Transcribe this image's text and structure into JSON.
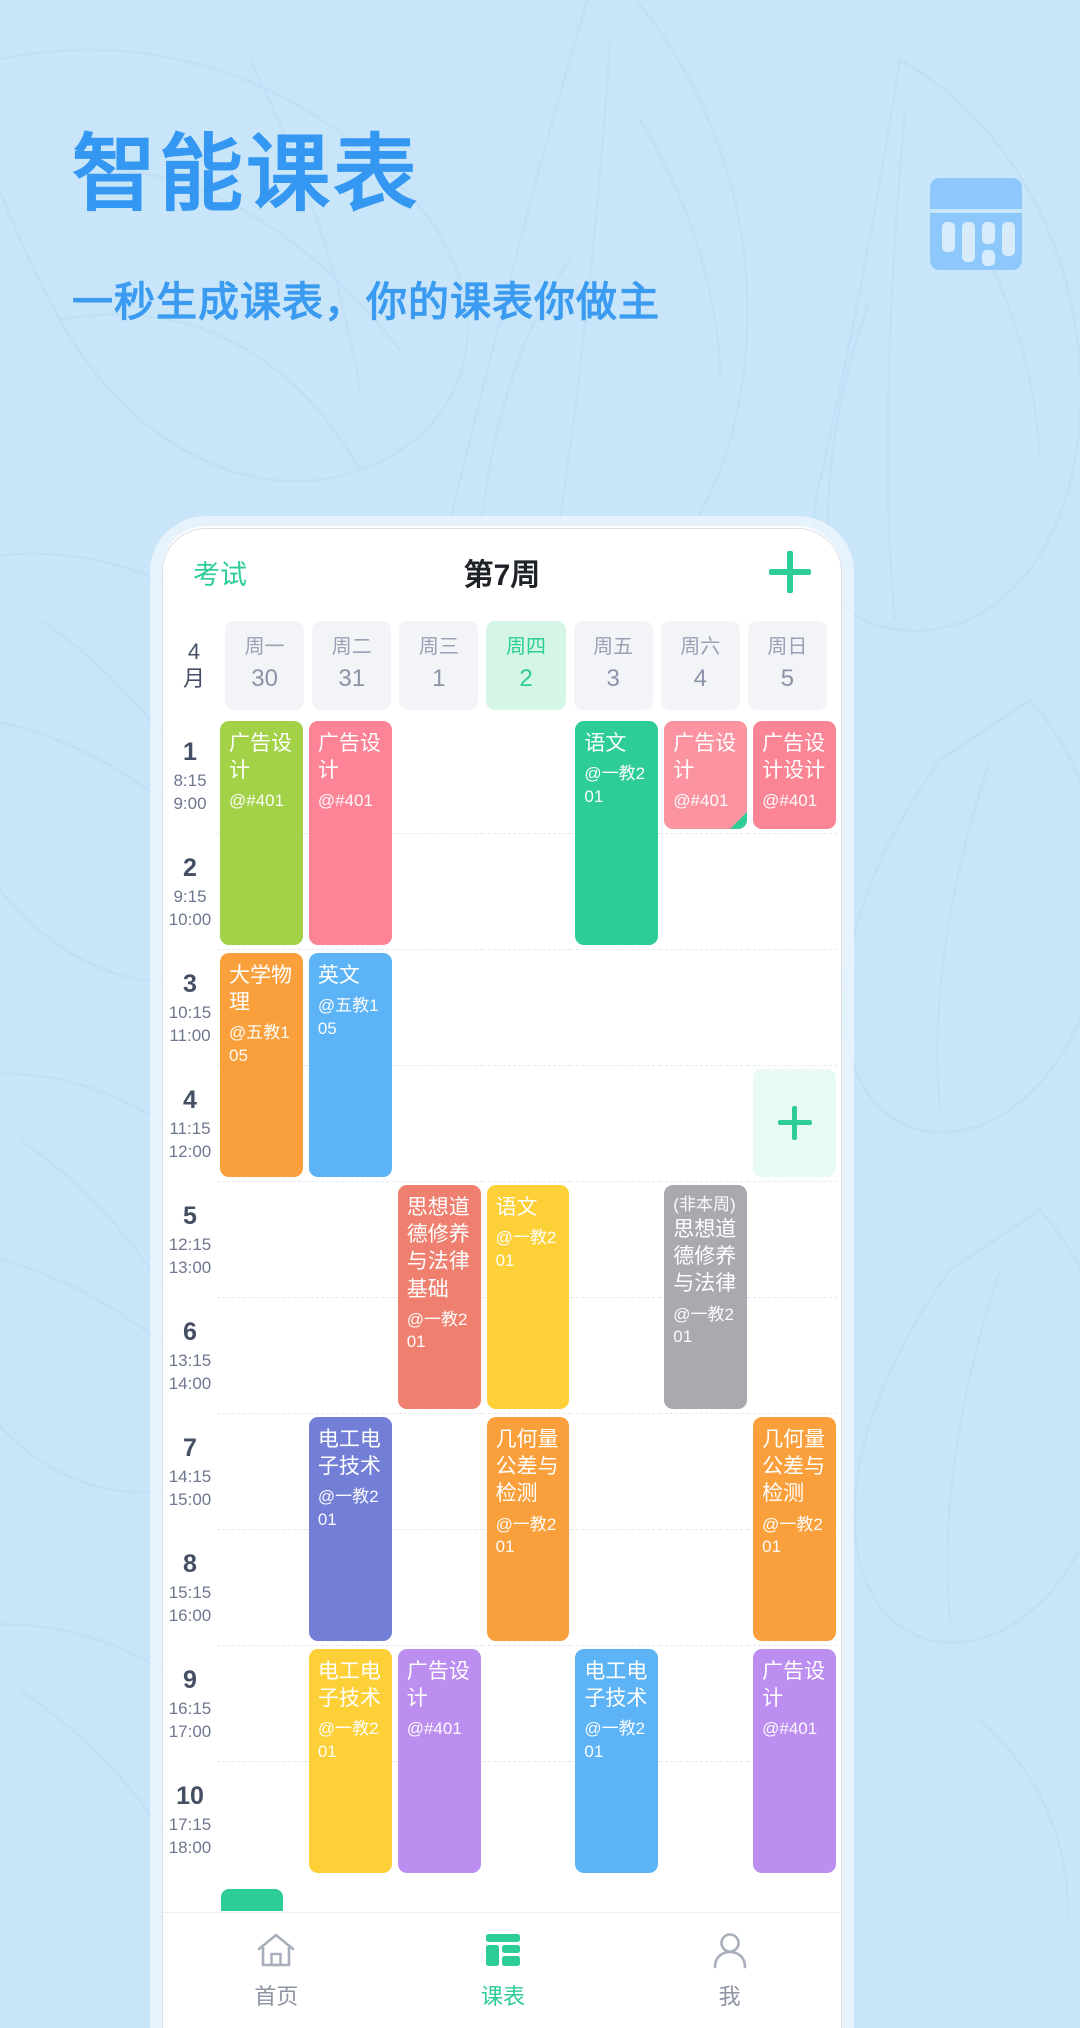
{
  "promo": {
    "title": "智能课表",
    "subtitle": "一秒生成课表，你的课表你做主",
    "icon": "calendar-table-icon",
    "bg_color": "#c8e5f9",
    "title_color": "#3498f3"
  },
  "appbar": {
    "left_label": "考试",
    "title": "第7周",
    "add_icon": "plus-icon",
    "accent_color": "#2ecd95"
  },
  "calendar": {
    "month_label_top": "4",
    "month_label_bottom": "月",
    "days": [
      {
        "weekday": "周一",
        "date": "30",
        "today": false
      },
      {
        "weekday": "周二",
        "date": "31",
        "today": false
      },
      {
        "weekday": "周三",
        "date": "1",
        "today": false
      },
      {
        "weekday": "周四",
        "date": "2",
        "today": true
      },
      {
        "weekday": "周五",
        "date": "3",
        "today": false
      },
      {
        "weekday": "周六",
        "date": "4",
        "today": false
      },
      {
        "weekday": "周日",
        "date": "5",
        "today": false
      }
    ],
    "slots": [
      {
        "no": "1",
        "start": "8:15",
        "end": "9:00"
      },
      {
        "no": "2",
        "start": "9:15",
        "end": "10:00"
      },
      {
        "no": "3",
        "start": "10:15",
        "end": "11:00"
      },
      {
        "no": "4",
        "start": "11:15",
        "end": "12:00"
      },
      {
        "no": "5",
        "start": "12:15",
        "end": "13:00"
      },
      {
        "no": "6",
        "start": "13:15",
        "end": "14:00"
      },
      {
        "no": "7",
        "start": "14:15",
        "end": "15:00"
      },
      {
        "no": "8",
        "start": "15:15",
        "end": "16:00"
      },
      {
        "no": "9",
        "start": "16:15",
        "end": "17:00"
      },
      {
        "no": "10",
        "start": "17:15",
        "end": "18:00"
      }
    ],
    "courses": [
      {
        "name": "广告设计",
        "location": "@#401",
        "prefix": "",
        "day": 1,
        "start": 1,
        "span": 2,
        "color": "#a3d147",
        "corner": false
      },
      {
        "name": "广告设计",
        "location": "@#401",
        "prefix": "",
        "day": 2,
        "start": 1,
        "span": 2,
        "color": "#fd8397",
        "corner": false
      },
      {
        "name": "语文",
        "location": "@一教201",
        "prefix": "",
        "day": 5,
        "start": 1,
        "span": 2,
        "color": "#2ecd95",
        "corner": false
      },
      {
        "name": "广告设计",
        "location": "@#401",
        "prefix": "",
        "day": 6,
        "start": 1,
        "span": 1,
        "color": "#fb93a0",
        "corner": true
      },
      {
        "name": "广告设计设计",
        "location": "@#401",
        "prefix": "",
        "day": 7,
        "start": 1,
        "span": 1,
        "color": "#fb8595",
        "corner": false
      },
      {
        "name": "大学物理",
        "location": "@五教105",
        "prefix": "",
        "day": 1,
        "start": 3,
        "span": 2,
        "color": "#f9a03c",
        "corner": false
      },
      {
        "name": "英文",
        "location": "@五教105",
        "prefix": "",
        "day": 2,
        "start": 3,
        "span": 2,
        "color": "#5cb3f5",
        "corner": false
      },
      {
        "name": "",
        "location": "",
        "prefix": "",
        "day": 7,
        "start": 4,
        "span": 1,
        "color": "#e8fbf2",
        "add": true
      },
      {
        "name": "思想道德修养与法律基础",
        "location": "@一教201",
        "prefix": "",
        "day": 3,
        "start": 5,
        "span": 2,
        "color": "#ef7f6e",
        "corner": false
      },
      {
        "name": "语文",
        "location": "@一教201",
        "prefix": "",
        "day": 4,
        "start": 5,
        "span": 2,
        "color": "#fdd037",
        "corner": false
      },
      {
        "name": "思想道德修养与法律",
        "location": "@一教201",
        "prefix": "(非本周)",
        "day": 6,
        "start": 5,
        "span": 2,
        "color": "#a9aab0",
        "corner": false
      },
      {
        "name": "电工电子技术",
        "location": "@一教201",
        "prefix": "",
        "day": 2,
        "start": 7,
        "span": 2,
        "color": "#737fd6",
        "corner": false
      },
      {
        "name": "几何量公差与检测",
        "location": "@一教201",
        "prefix": "",
        "day": 4,
        "start": 7,
        "span": 2,
        "color": "#f9a03c",
        "corner": false
      },
      {
        "name": "几何量公差与检测",
        "location": "@一教201",
        "prefix": "",
        "day": 7,
        "start": 7,
        "span": 2,
        "color": "#f9a03c",
        "corner": false
      },
      {
        "name": "电工电子技术",
        "location": "@一教201",
        "prefix": "",
        "day": 2,
        "start": 9,
        "span": 2,
        "color": "#fdd037",
        "corner": false
      },
      {
        "name": "广告设计",
        "location": "@#401",
        "prefix": "",
        "day": 3,
        "start": 9,
        "span": 2,
        "color": "#bb8ef0",
        "corner": false
      },
      {
        "name": "电工电子技术",
        "location": "@一教201",
        "prefix": "",
        "day": 5,
        "start": 9,
        "span": 2,
        "color": "#5cb3f5",
        "corner": false
      },
      {
        "name": "广告设计",
        "location": "@#401",
        "prefix": "",
        "day": 7,
        "start": 9,
        "span": 2,
        "color": "#bb8ef0",
        "corner": false
      }
    ]
  },
  "tabbar": {
    "items": [
      {
        "label": "首页",
        "icon": "home-icon",
        "active": false
      },
      {
        "label": "课表",
        "icon": "grid-icon",
        "active": true
      },
      {
        "label": "我",
        "icon": "person-icon",
        "active": false
      }
    ]
  }
}
